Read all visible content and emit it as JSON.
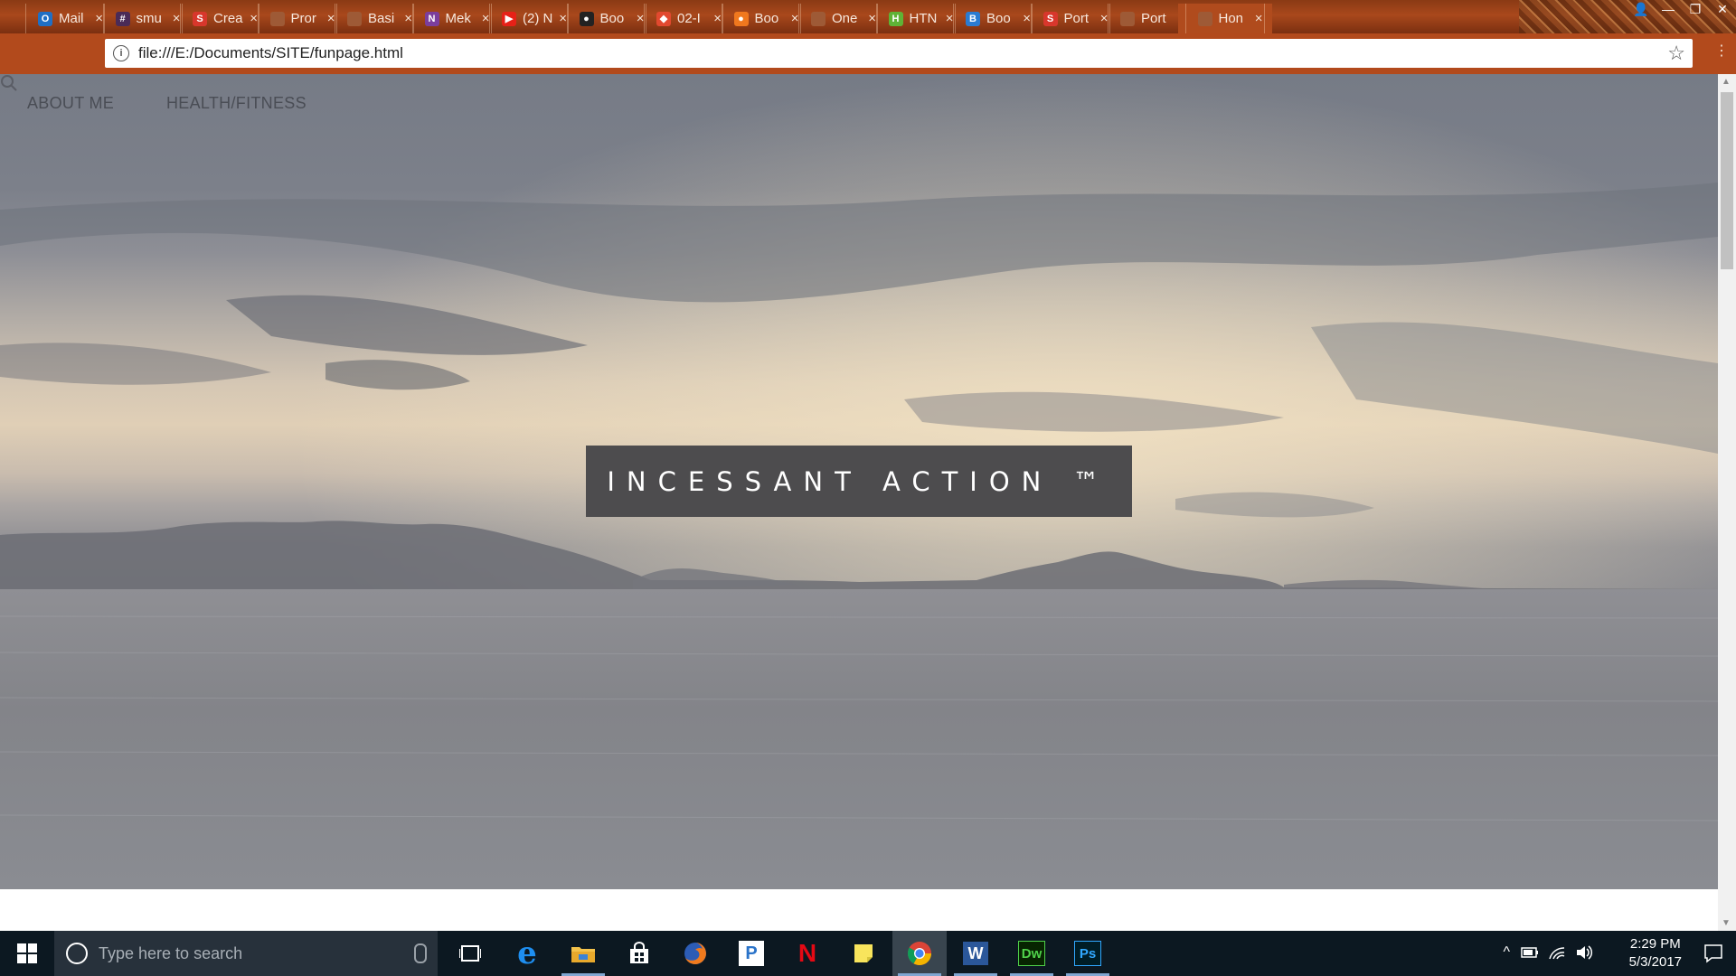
{
  "browser": {
    "tabs": [
      {
        "title": "Mail",
        "favicon": "outlook-icon",
        "color": "#1f6fc5",
        "glyph": "O"
      },
      {
        "title": "smu",
        "favicon": "slack-icon",
        "color": "#4a2b57",
        "glyph": "#"
      },
      {
        "title": "Crea",
        "favicon": "s-logo-icon",
        "color": "#d8372c",
        "glyph": "S"
      },
      {
        "title": "Pror",
        "favicon": "page-icon",
        "color": "#9e5a36",
        "glyph": ""
      },
      {
        "title": "Basi",
        "favicon": "page-icon",
        "color": "#9e5a36",
        "glyph": ""
      },
      {
        "title": "Mek",
        "favicon": "onenote-icon",
        "color": "#7b3e9c",
        "glyph": "N"
      },
      {
        "title": "(2) N",
        "favicon": "youtube-icon",
        "color": "#e62117",
        "glyph": "▶"
      },
      {
        "title": "Boo",
        "favicon": "github-icon",
        "color": "#222222",
        "glyph": "●"
      },
      {
        "title": "02-I",
        "favicon": "gitlab-icon",
        "color": "#e2492f",
        "glyph": "◆"
      },
      {
        "title": "Boo",
        "favicon": "orange-circle-icon",
        "color": "#f0781e",
        "glyph": "●"
      },
      {
        "title": "One",
        "favicon": "page-icon",
        "color": "#9e5a36",
        "glyph": ""
      },
      {
        "title": "HTN",
        "favicon": "html-icon",
        "color": "#5fb336",
        "glyph": "H"
      },
      {
        "title": "Boo",
        "favicon": "bootstrap-icon",
        "color": "#2a7bd1",
        "glyph": "B"
      },
      {
        "title": "Port",
        "favicon": "s-logo-icon",
        "color": "#d8372c",
        "glyph": "S"
      },
      {
        "title": "Port",
        "favicon": "page-icon",
        "color": "#9e5a36",
        "glyph": ""
      },
      {
        "title": "Hon",
        "favicon": "page-icon",
        "color": "#9e5a36",
        "glyph": "",
        "active": true
      }
    ],
    "tab_close": "×",
    "window_controls": {
      "user": "👤",
      "minimize": "—",
      "restore": "❐",
      "close": "✕"
    },
    "url": "file:///E:/Documents/SITE/funpage.html",
    "info_glyph": "i",
    "star_glyph": "☆",
    "menu_glyph": "⋮"
  },
  "page": {
    "nav": {
      "about": "ABOUT ME",
      "health": "HEALTH/FITNESS"
    },
    "hero_title": "INCESSANT ACTION ™"
  },
  "taskbar": {
    "search_placeholder": "Type here to search",
    "apps": [
      {
        "name": "task-view-icon",
        "running": false
      },
      {
        "name": "edge-icon",
        "running": false
      },
      {
        "name": "file-explorer-icon",
        "running": true
      },
      {
        "name": "store-icon",
        "running": false
      },
      {
        "name": "firefox-icon",
        "running": false
      },
      {
        "name": "pandora-icon",
        "running": false
      },
      {
        "name": "netflix-icon",
        "running": false
      },
      {
        "name": "sticky-notes-icon",
        "running": false
      },
      {
        "name": "chrome-icon",
        "running": true,
        "active": true
      },
      {
        "name": "word-icon",
        "running": true
      },
      {
        "name": "dreamweaver-icon",
        "running": true
      },
      {
        "name": "photoshop-icon",
        "running": true
      }
    ],
    "word_letter": "W",
    "dw_letters": "Dw",
    "ps_letters": "Ps",
    "netflix_letter": "N",
    "pandora_letter": "P",
    "time": "2:29 PM",
    "date": "5/3/2017",
    "tray_chevron": "^",
    "colors": {
      "dw": "#4fd24a",
      "ps": "#31a8ff",
      "word": "#2b579a",
      "netflix": "#e50914"
    }
  }
}
